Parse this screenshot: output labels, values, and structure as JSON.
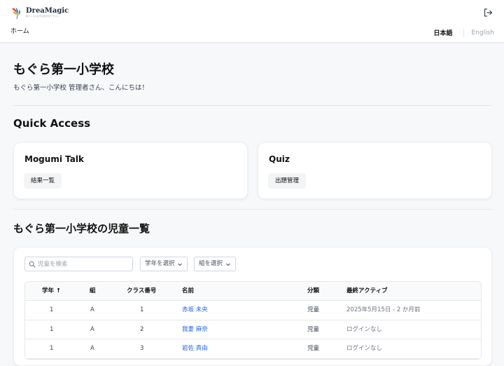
{
  "header": {
    "logo_name": "DreaMagic",
    "logo_tagline": "夢つくる心を育む教育をデザイン",
    "nav_home": "ホーム",
    "lang_ja": "日本語",
    "lang_en": "English"
  },
  "page": {
    "title": "もぐら第一小学校",
    "greeting": "もぐら第一小学校 管理者さん、こんにちは！"
  },
  "quick_access": {
    "title": "Quick Access",
    "cards": [
      {
        "title": "Mogumi Talk",
        "action": "結果一覧"
      },
      {
        "title": "Quiz",
        "action": "出題管理"
      }
    ]
  },
  "students": {
    "title": "もぐら第一小学校の児童一覧",
    "search_placeholder": "児童を検索",
    "grade_select": "学年を選択",
    "class_select": "組を選択",
    "columns": {
      "grade": "学年",
      "sort_indicator": "↑",
      "class": "組",
      "number": "クラス番号",
      "name": "名前",
      "category": "分類",
      "last_active": "最終アクティブ"
    },
    "rows": [
      {
        "grade": "1",
        "class": "A",
        "number": "1",
        "name": "赤坂 未央",
        "category": "児童",
        "last_active": "2025年5月15日 - 2 か月前"
      },
      {
        "grade": "1",
        "class": "A",
        "number": "2",
        "name": "我妻 麻奈",
        "category": "児童",
        "last_active": "ログインなし"
      },
      {
        "grade": "1",
        "class": "A",
        "number": "3",
        "name": "岩佐 真由",
        "category": "児童",
        "last_active": "ログインなし"
      }
    ]
  },
  "colors": {
    "accent_link": "#2563eb",
    "background": "#f7f8fa"
  }
}
